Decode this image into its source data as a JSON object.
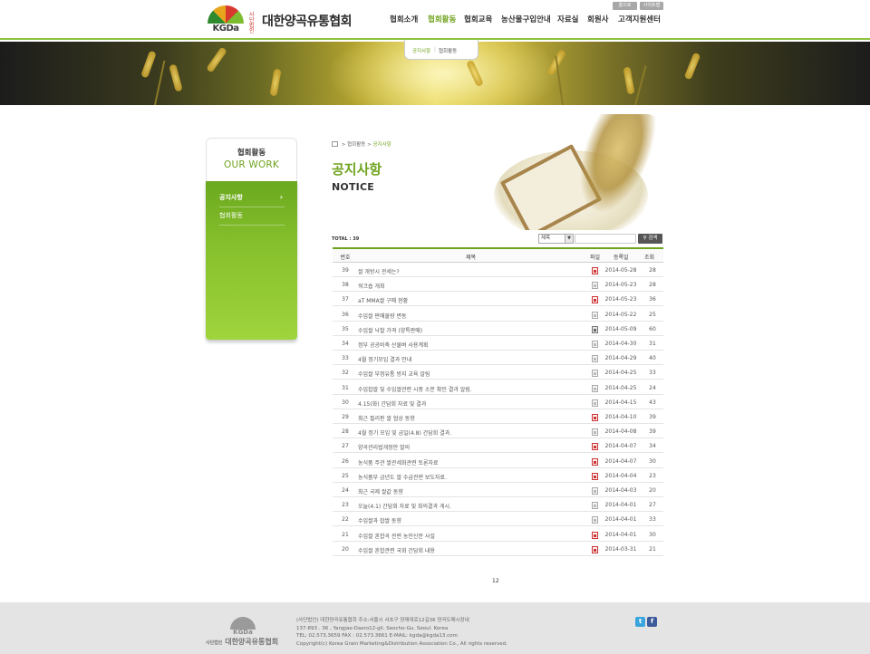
{
  "header": {
    "logo": {
      "brand": "KGDa",
      "org_type": "사단법인",
      "name": "대한양곡유통협회"
    },
    "util": {
      "home": "홈으로",
      "sitemap": "사이트맵"
    },
    "nav": [
      {
        "label": "협회소개"
      },
      {
        "label": "협회활동"
      },
      {
        "label": "협회교육"
      },
      {
        "label": "농산물구입안내"
      },
      {
        "label": "자료실"
      },
      {
        "label": "회원사"
      },
      {
        "label": "고객지원센터"
      }
    ],
    "subnav": {
      "active": "공지사항",
      "separator": "|",
      "other": "협회활동"
    }
  },
  "sidebar": {
    "title_ko": "협회활동",
    "title_en": "OUR WORK",
    "items": [
      {
        "label": "공지사항",
        "chevron": "›"
      },
      {
        "label": "협회활동"
      }
    ]
  },
  "content": {
    "breadcrumb": {
      "parent": "협회활동",
      "sep": ">",
      "current": "공지사항",
      "lead": ">"
    },
    "title": "공지사항",
    "subtitle": "NOTICE",
    "total": "TOTAL : 39",
    "search": {
      "field": "제목",
      "dropdown_arrow": "▼",
      "button": "검색"
    },
    "table": {
      "headers": {
        "num": "번호",
        "title": "제목",
        "file": "파일",
        "date": "등록일",
        "views": "조회"
      },
      "rows": [
        {
          "num": "39",
          "title": "쌀 개방시 관세는?",
          "file": "pdf",
          "date": "2014-05-28",
          "views": "28"
        },
        {
          "num": "38",
          "title": "워크숍 개최",
          "file": "none",
          "date": "2014-05-23",
          "views": "28"
        },
        {
          "num": "37",
          "title": "aT MMA쌀 구매 현황",
          "file": "pdf",
          "date": "2014-05-23",
          "views": "36"
        },
        {
          "num": "36",
          "title": "수입쌀 판매물량 변동",
          "file": "none",
          "date": "2014-05-22",
          "views": "25"
        },
        {
          "num": "35",
          "title": "수입쌀 낙찰 가격 (양특판매)",
          "file": "img",
          "date": "2014-05-09",
          "views": "60"
        },
        {
          "num": "34",
          "title": "정부 공공비축 산물벼 사용계획",
          "file": "none",
          "date": "2014-04-30",
          "views": "31"
        },
        {
          "num": "33",
          "title": "4월 정기모임 결과 안내",
          "file": "none",
          "date": "2014-04-29",
          "views": "40"
        },
        {
          "num": "32",
          "title": "수입쌀 부정유통 방지 교육 알림",
          "file": "none",
          "date": "2014-04-25",
          "views": "33"
        },
        {
          "num": "31",
          "title": "수입잡쌀 및 수입쌀관련 시중 소문 확인 결과 알림.",
          "file": "none",
          "date": "2014-04-25",
          "views": "24"
        },
        {
          "num": "30",
          "title": "4.15(화) 간담회 자료 및 결과",
          "file": "none",
          "date": "2014-04-15",
          "views": "43"
        },
        {
          "num": "29",
          "title": "최근 필리핀 쌀 협상 동향",
          "file": "pdf",
          "date": "2014-04-10",
          "views": "39"
        },
        {
          "num": "28",
          "title": "4월 정기 모임 및 금일(4.8) 간담회 결과.",
          "file": "none",
          "date": "2014-04-08",
          "views": "39"
        },
        {
          "num": "27",
          "title": "양곡관리법개정안 발의",
          "file": "pdf",
          "date": "2014-04-07",
          "views": "34"
        },
        {
          "num": "26",
          "title": "농식품 주관 쌀관세화관련 토론자료",
          "file": "pdf",
          "date": "2014-04-07",
          "views": "30"
        },
        {
          "num": "25",
          "title": "농식품부 금년도 쌀 수급관련 보도자료.",
          "file": "pdf",
          "date": "2014-04-04",
          "views": "23"
        },
        {
          "num": "24",
          "title": "최근 국제 쌀값 동향",
          "file": "none",
          "date": "2014-04-03",
          "views": "20"
        },
        {
          "num": "23",
          "title": "오늘(4.1) 간담회 자료 및 회의결과 게시.",
          "file": "none",
          "date": "2014-04-01",
          "views": "27"
        },
        {
          "num": "22",
          "title": "수입쌀과 잡쌀 동향",
          "file": "none",
          "date": "2014-04-01",
          "views": "33"
        },
        {
          "num": "21",
          "title": "수입쌀 혼합곡 관련 농민신문 사설",
          "file": "pdf",
          "date": "2014-04-01",
          "views": "30"
        },
        {
          "num": "20",
          "title": "수입쌀 혼합관련 국회 간담회 내용",
          "file": "pdf",
          "date": "2014-03-31",
          "views": "21"
        }
      ]
    },
    "pagination": "12"
  },
  "footer": {
    "brand": "KGDa",
    "org_type": "사단법인",
    "name": "대한양곡유통협회",
    "lines": [
      "(사단법인) 대한양곡유통협회 주소:서울시 서초구 양재대로12길36 양곡도매시장내",
      "137-893 . 36 , Yangjae-Daero12-gil. Seocho-Gu. Seoul. Korea",
      "TEL: 02.573.3659 FAX : 02.573.3661 E-MAIL: kgda@kgda13.com",
      "Copyright(c) Korea Grain Marketing&Distribution Association Co., All rights reserved."
    ],
    "sns": {
      "twitter": "t",
      "facebook": "f"
    }
  },
  "colors": {
    "accent": "#6fa31e",
    "sidebar_green": "#86c02c",
    "footer_bg": "#e4e4e4"
  },
  "icons": [
    "home-icon",
    "chevron-right-icon",
    "file-pdf-icon",
    "file-icon",
    "file-image-icon",
    "search-icon",
    "twitter-icon",
    "facebook-icon"
  ]
}
